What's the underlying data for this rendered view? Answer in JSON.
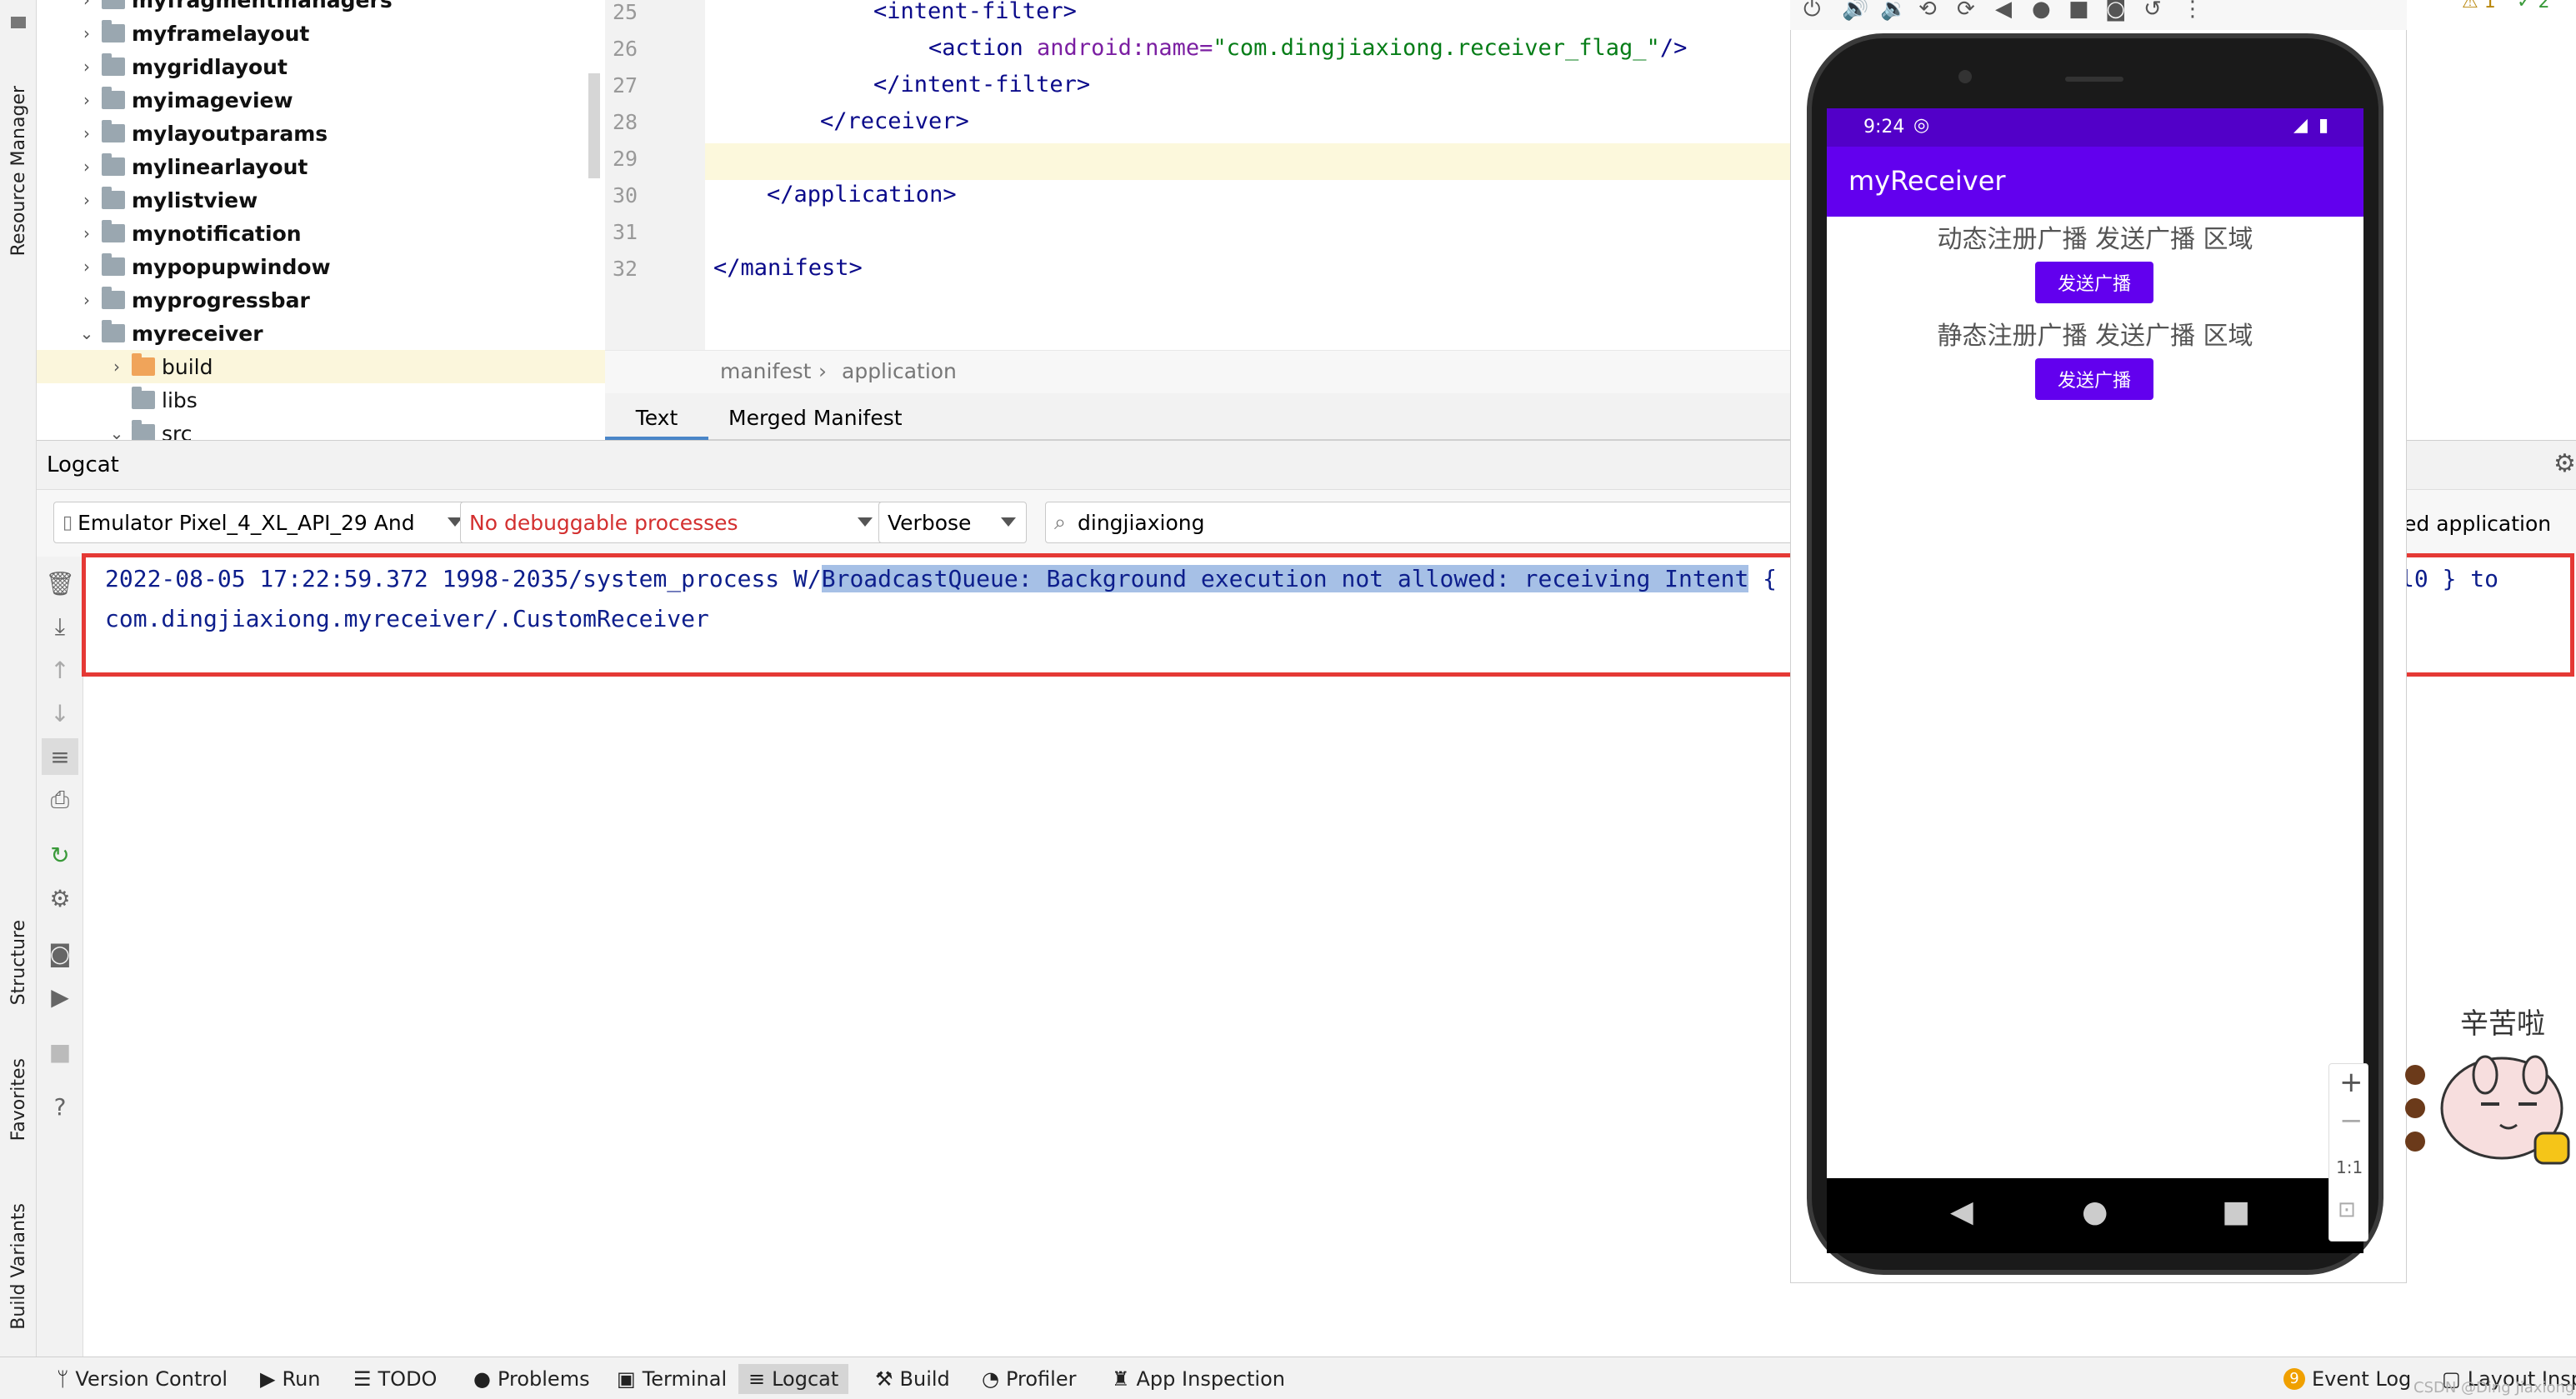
{
  "left_strip": {
    "tabs": [
      "Resource Manager",
      "Structure",
      "Favorites",
      "Build Variants"
    ]
  },
  "tree": {
    "items": [
      {
        "label": "myfragmentmanagers",
        "expanded": false
      },
      {
        "label": "myframelayout",
        "expanded": false
      },
      {
        "label": "mygridlayout",
        "expanded": false
      },
      {
        "label": "myimageview",
        "expanded": false
      },
      {
        "label": "mylayoutparams",
        "expanded": false
      },
      {
        "label": "mylinearlayout",
        "expanded": false
      },
      {
        "label": "mylistview",
        "expanded": false
      },
      {
        "label": "mynotification",
        "expanded": false
      },
      {
        "label": "mypopupwindow",
        "expanded": false
      },
      {
        "label": "myprogressbar",
        "expanded": false
      },
      {
        "label": "myreceiver",
        "expanded": true
      },
      {
        "label": "build",
        "expanded": false
      },
      {
        "label": "libs",
        "expanded": false
      },
      {
        "label": "src",
        "expanded": true
      }
    ]
  },
  "editor": {
    "line_numbers": [
      "25",
      "26",
      "27",
      "28",
      "29",
      "30",
      "31",
      "32"
    ],
    "code": {
      "l25": "<intent-filter>",
      "l26_tag": "<action ",
      "l26_attr": "android:name=",
      "l26_val": "\"com.dingjiaxiong.receiver_flag_\"",
      "l26_end": "/>",
      "l27": "</intent-filter>",
      "l28": "</receiver>",
      "l30": "</application>",
      "l32": "</manifest>"
    },
    "breadcrumb": [
      "manifest",
      "application"
    ],
    "tabs": [
      "Text",
      "Merged Manifest"
    ]
  },
  "logcat": {
    "title": "Logcat",
    "device": "Emulator Pixel_4_XL_API_29 And",
    "process": "No debuggable processes",
    "level": "Verbose",
    "search": "dingjiaxiong",
    "filter_right": "ed application",
    "log_line1_prefix": "2022-08-05 17:22:59.372 1998-2035/system_process W/",
    "log_line1_highlight": "BroadcastQueue: Background execution not allowed: receiving Intent",
    "log_line1_after": " {",
    "log_line1_tail": "l0 } to",
    "log_line2": "com.dingjiaxiong.myreceiver/.CustomReceiver"
  },
  "emulator": {
    "time": "9:24",
    "app_title": "myReceiver",
    "dynamic_label": "动态注册广播 发送广播 区域",
    "dynamic_button": "发送广播",
    "static_label": "静态注册广播 发送广播 区域",
    "static_button": "发送广播",
    "zoom_ratio": "1:1"
  },
  "sticker": {
    "text": "辛苦啦"
  },
  "bottom_bar": {
    "items": [
      "Version Control",
      "Run",
      "TODO",
      "Problems",
      "Terminal",
      "Logcat",
      "Build",
      "Profiler",
      "App Inspection"
    ],
    "event_log_count": "9",
    "event_log": "Event Log",
    "layout_inspector": "Layout Inspe",
    "watermark": "CSDN @Ding Jiaxiong"
  },
  "warnings": {
    "count": "1",
    "ok": "2"
  }
}
